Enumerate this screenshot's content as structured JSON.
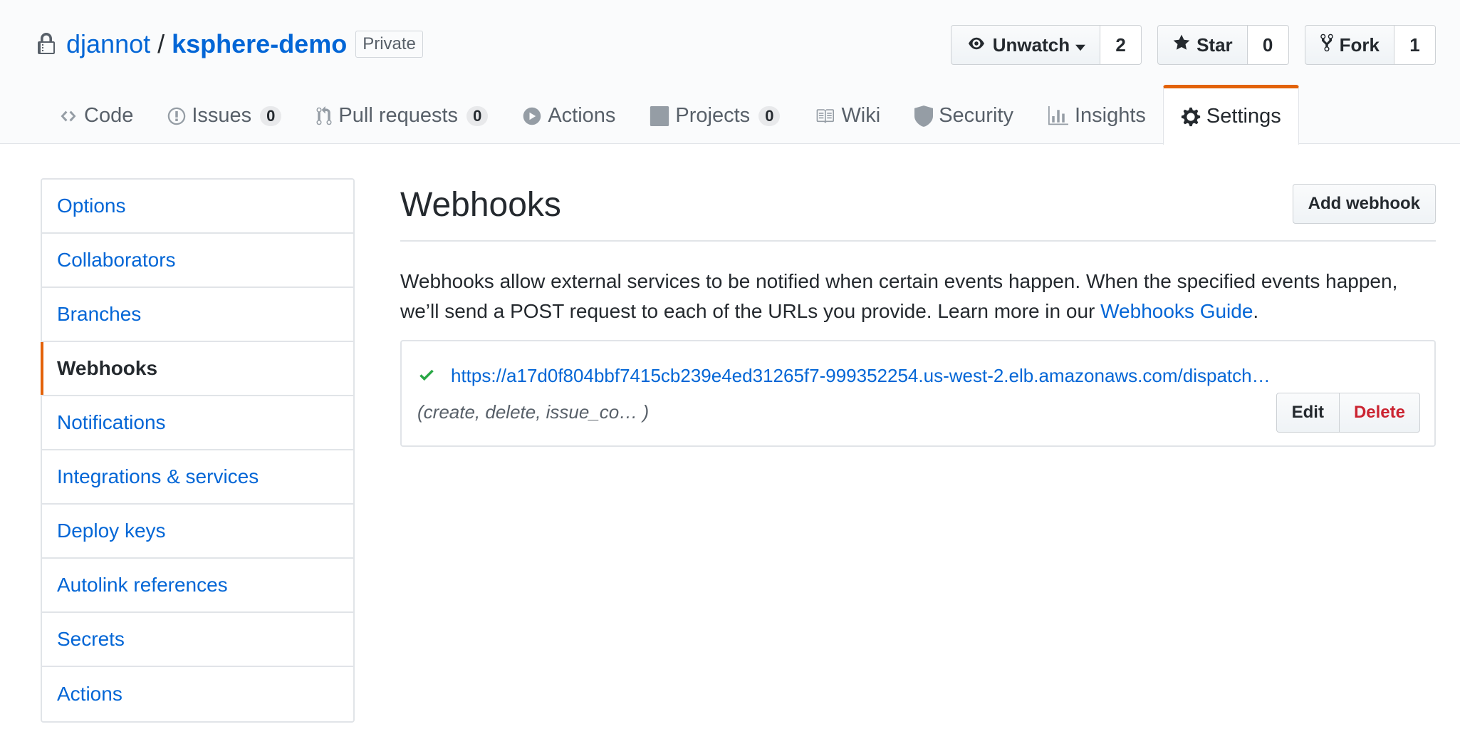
{
  "repo": {
    "owner": "djannot",
    "separator": "/",
    "name": "ksphere-demo",
    "visibility": "Private"
  },
  "actions": {
    "watch": {
      "label": "Unwatch",
      "count": "2"
    },
    "star": {
      "label": "Star",
      "count": "0"
    },
    "fork": {
      "label": "Fork",
      "count": "1"
    }
  },
  "tabs": [
    {
      "label": "Code",
      "icon": "code-icon"
    },
    {
      "label": "Issues",
      "icon": "issue-icon",
      "count": "0"
    },
    {
      "label": "Pull requests",
      "icon": "pull-request-icon",
      "count": "0"
    },
    {
      "label": "Actions",
      "icon": "play-icon"
    },
    {
      "label": "Projects",
      "icon": "project-icon",
      "count": "0"
    },
    {
      "label": "Wiki",
      "icon": "book-icon"
    },
    {
      "label": "Security",
      "icon": "shield-icon"
    },
    {
      "label": "Insights",
      "icon": "graph-icon"
    },
    {
      "label": "Settings",
      "icon": "gear-icon",
      "selected": true
    }
  ],
  "sidebar": {
    "items": [
      {
        "label": "Options"
      },
      {
        "label": "Collaborators"
      },
      {
        "label": "Branches"
      },
      {
        "label": "Webhooks",
        "active": true
      },
      {
        "label": "Notifications"
      },
      {
        "label": "Integrations & services"
      },
      {
        "label": "Deploy keys"
      },
      {
        "label": "Autolink references"
      },
      {
        "label": "Secrets"
      },
      {
        "label": "Actions"
      }
    ]
  },
  "main": {
    "title": "Webhooks",
    "add_button": "Add webhook",
    "description": "Webhooks allow external services to be notified when certain events happen. When the specified events happen, we’ll send a POST request to each of the URLs you provide. Learn more in our ",
    "guide_link": "Webhooks Guide",
    "description_end": ".",
    "hook": {
      "url": "https://a17d0f804bbf7415cb239e4ed31265f7-999352254.us-west-2.elb.amazonaws.com/dispatch…",
      "events": "(create, delete, issue_co…  )",
      "edit_label": "Edit",
      "delete_label": "Delete"
    }
  },
  "colors": {
    "link": "#0366d6",
    "active_accent": "#e36209",
    "success": "#28a745",
    "danger": "#cb2431"
  }
}
